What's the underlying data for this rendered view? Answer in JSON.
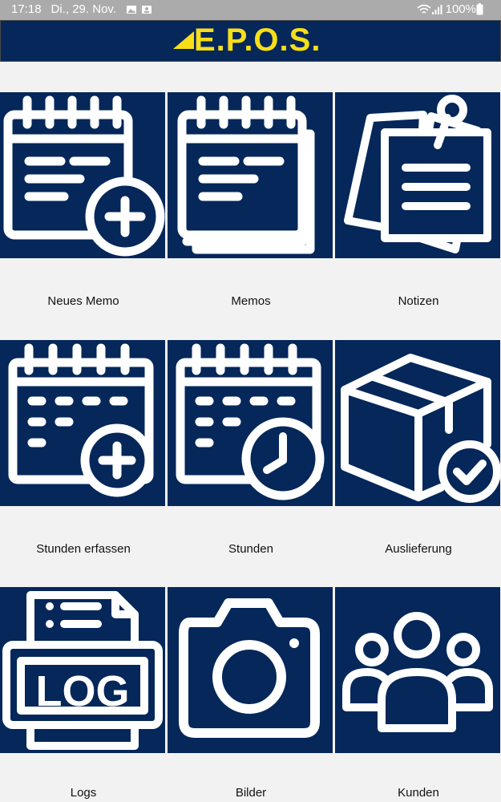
{
  "status_bar": {
    "time": "17:18",
    "date": "Di., 29. Nov.",
    "battery": "100%",
    "icons": [
      "gallery-icon",
      "screenshot-icon",
      "wifi-icon",
      "signal-icon",
      "battery-icon"
    ]
  },
  "app_bar": {
    "logo_text": "E.P.O.S.",
    "logo_color": "#f7de18",
    "background": "#05275a"
  },
  "tiles": [
    {
      "label": "Neues Memo",
      "icon": "new-memo-icon"
    },
    {
      "label": "Memos",
      "icon": "memos-icon"
    },
    {
      "label": "Notizen",
      "icon": "notes-icon"
    },
    {
      "label": "Stunden erfassen",
      "icon": "add-hours-icon"
    },
    {
      "label": "Stunden",
      "icon": "hours-icon"
    },
    {
      "label": "Auslieferung",
      "icon": "delivery-box-icon"
    },
    {
      "label": "Logs",
      "icon": "log-printer-icon"
    },
    {
      "label": "Bilder",
      "icon": "camera-icon"
    },
    {
      "label": "Kunden",
      "icon": "customers-icon"
    }
  ]
}
